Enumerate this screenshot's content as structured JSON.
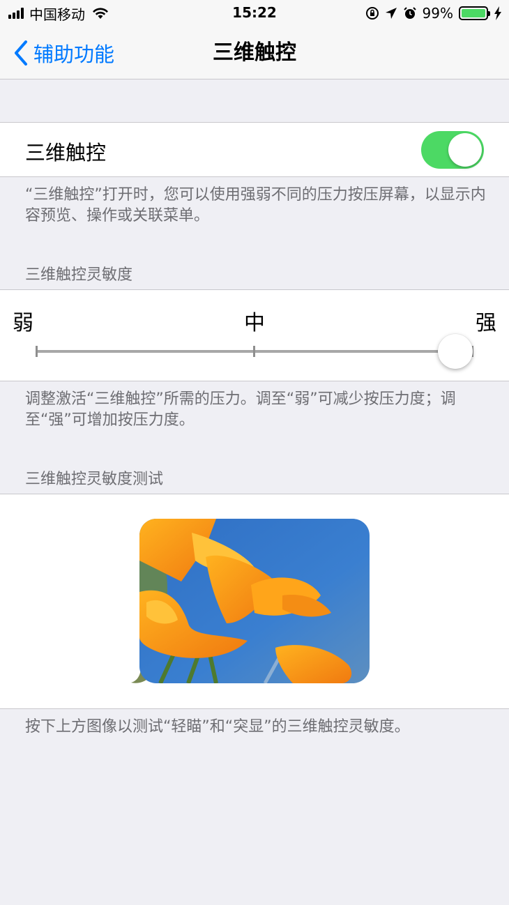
{
  "status_bar": {
    "carrier": "中国移动",
    "time": "15:22",
    "battery_percent": "99%",
    "battery_level": 0.99
  },
  "nav": {
    "back_label": "辅助功能",
    "title": "三维触控"
  },
  "toggle": {
    "label": "三维触控",
    "on": true
  },
  "toggle_footer": "“三维触控”打开时，您可以使用强弱不同的压力按压屏幕，以显示内容预览、操作或关联菜单。",
  "sensitivity": {
    "header": "三维触控灵敏度",
    "labels": [
      "弱",
      "中",
      "强"
    ],
    "value": 1.0
  },
  "sensitivity_footer": "调整激活“三维触控”所需的压力。调至“弱”可减少按压力度；调至“强”可增加按压力度。",
  "test": {
    "header": "三维触控灵敏度测试",
    "footer": "按下上方图像以测试“轻瞄”和“突显”的三维触控灵敏度。"
  },
  "colors": {
    "accent": "#007aff",
    "switch_on": "#4cd964",
    "background": "#efeff4",
    "secondary_text": "#6d6d72"
  }
}
